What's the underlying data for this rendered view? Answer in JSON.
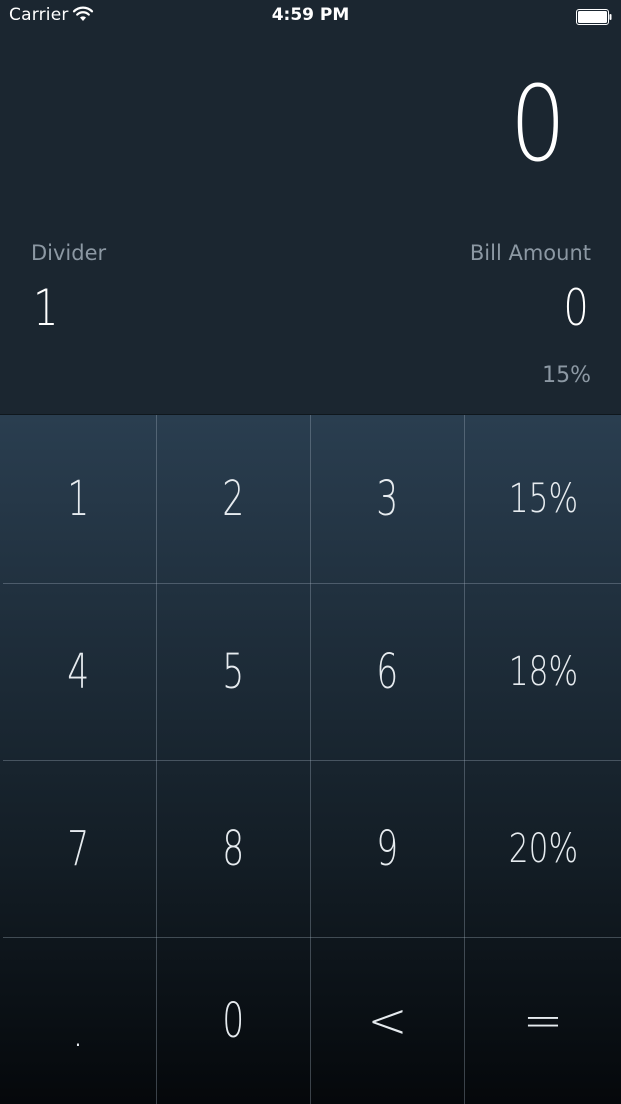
{
  "status_bar": {
    "carrier": "Carrier",
    "time": "4:59 PM",
    "icons": [
      "wifi-icon",
      "battery-icon"
    ]
  },
  "display": {
    "result": "0",
    "divider_label": "Divider",
    "divider_value": "1",
    "bill_label": "Bill Amount",
    "bill_value": "0",
    "tip_percent": "15%"
  },
  "keypad": {
    "rows": [
      [
        "1",
        "2",
        "3",
        "15%"
      ],
      [
        "4",
        "5",
        "6",
        "18%"
      ],
      [
        "7",
        "8",
        "9",
        "20%"
      ],
      [
        ".",
        "0",
        "<",
        "="
      ]
    ]
  },
  "colors": {
    "display_bg": "#1b2630",
    "label": "#8c98a3",
    "keypad_top": "#2a3e50",
    "keypad_bottom": "#05080b"
  }
}
